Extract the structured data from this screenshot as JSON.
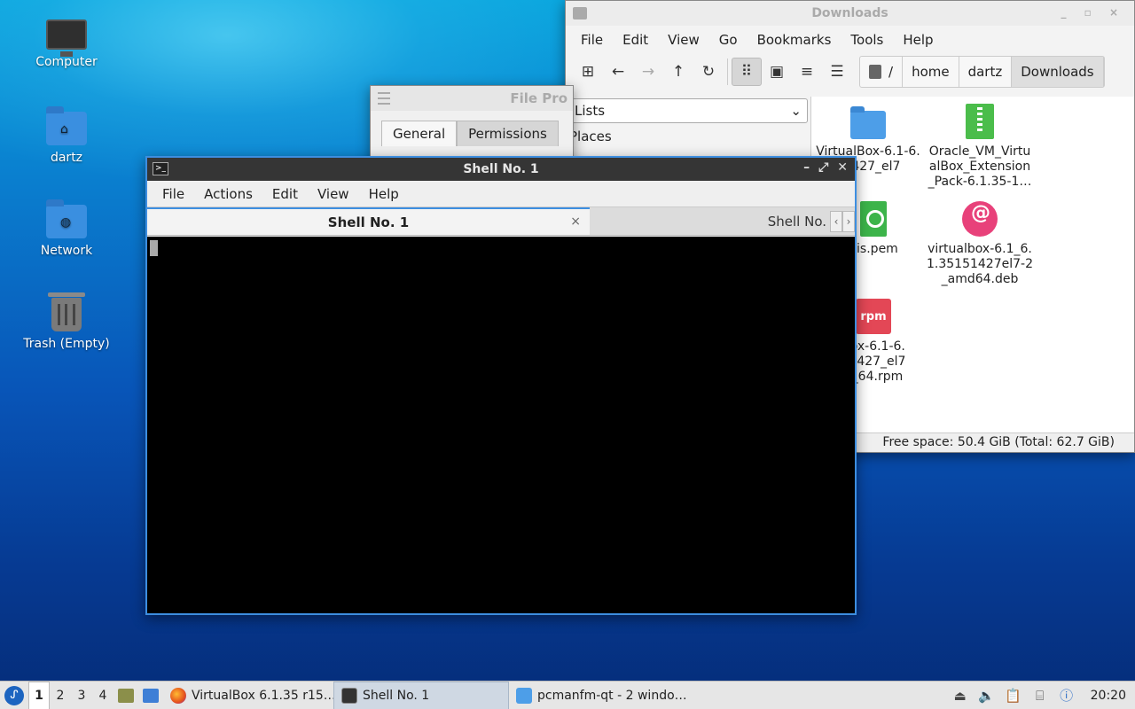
{
  "desktop": {
    "icons": [
      {
        "label": "Computer"
      },
      {
        "label": "dartz"
      },
      {
        "label": "Network"
      },
      {
        "label": "Trash (Empty)"
      }
    ]
  },
  "downloads_window": {
    "title": "Downloads",
    "menu": [
      "File",
      "Edit",
      "View",
      "Go",
      "Bookmarks",
      "Tools",
      "Help"
    ],
    "path": [
      "/",
      "home",
      "dartz",
      "Downloads"
    ],
    "side_select": "Lists",
    "side_heading": "Places",
    "files": [
      {
        "name": "VirtualBox-6.1-6.\n51427_el7",
        "type": "folder"
      },
      {
        "name": "Oracle_VM_Virtu\nalBox_Extension\n_Pack-6.1.35-1…",
        "type": "zip"
      },
      {
        "name": "his.pem",
        "type": "cert"
      },
      {
        "name": "virtualbox-6.1_6.\n1.35151427el7-2\n_amd64.deb",
        "type": "deb"
      },
      {
        "name": "Box-6.1-6.\n51427_el7\n6_64.rpm",
        "type": "rpm"
      }
    ],
    "rpm_label": "rpm",
    "status": "Free space: 50.4 GiB (Total: 62.7 GiB)"
  },
  "fileprops_window": {
    "title": "File Pro",
    "tabs": [
      "General",
      "Permissions"
    ]
  },
  "shell_window": {
    "title": "Shell No. 1",
    "menu": [
      "File",
      "Actions",
      "Edit",
      "View",
      "Help"
    ],
    "tabs": [
      {
        "label": "Shell No. 1",
        "close": "×"
      },
      {
        "label": "Shell No."
      }
    ]
  },
  "taskbar": {
    "workspaces": [
      "1",
      "2",
      "3",
      "4"
    ],
    "tasks": [
      {
        "label": "VirtualBox 6.1.35 r15…"
      },
      {
        "label": "Shell No. 1"
      },
      {
        "label": "pcmanfm-qt - 2 windo…"
      }
    ],
    "clock": "20:20"
  }
}
